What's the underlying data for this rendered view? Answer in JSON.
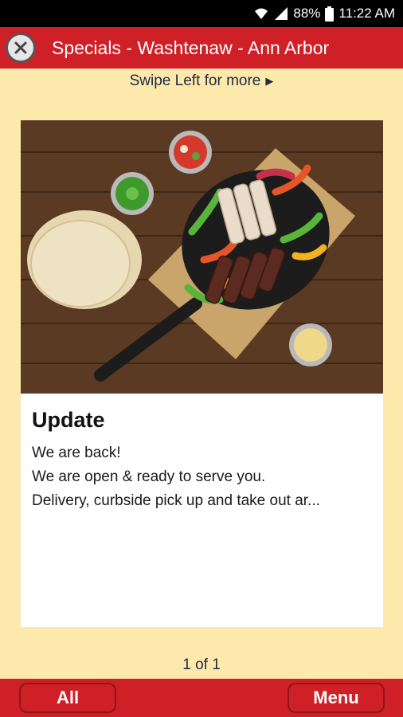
{
  "status_bar": {
    "battery": "88%",
    "time": "11:22 AM",
    "wifi_icon": "wifi-icon",
    "signal_icon": "signal-icon",
    "battery_icon": "battery-icon"
  },
  "header": {
    "title": "Specials - Washtenaw - Ann Arbor",
    "close_icon": "close-icon",
    "background_color": "#cf2027"
  },
  "swipe_hint": {
    "text": "Swipe Left for more",
    "arrow": "▶"
  },
  "card": {
    "image": "fajitas-skillet-image",
    "title": "Update",
    "lines": [
      "We are back!",
      "We are open & ready to serve you.",
      "Delivery, curbside pick up and take out ar..."
    ]
  },
  "pager": {
    "text": "1 of 1"
  },
  "bottom_bar": {
    "all_label": "All",
    "menu_label": "Menu"
  },
  "colors": {
    "page_background": "#fde9ab",
    "accent_red": "#cf2027"
  }
}
